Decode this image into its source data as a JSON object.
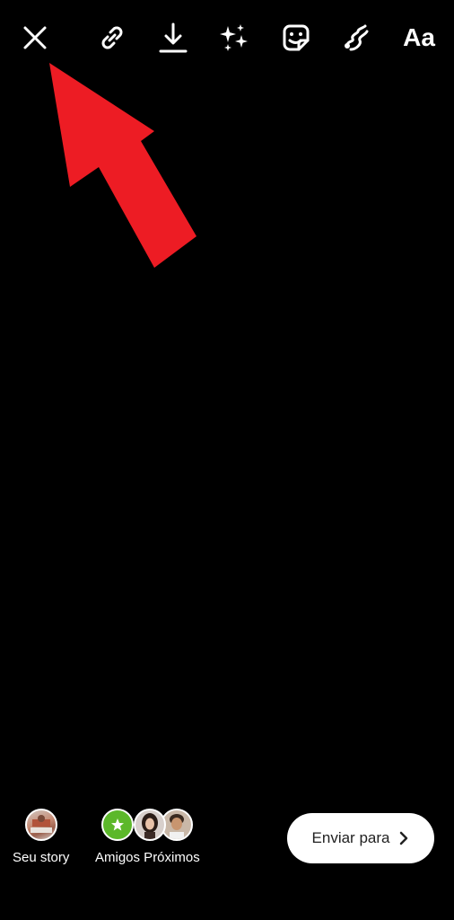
{
  "toolbar": {
    "close_icon": "close-icon",
    "link_icon": "link-icon",
    "download_icon": "download-icon",
    "effects_icon": "sparkles-icon",
    "sticker_icon": "sticker-icon",
    "draw_icon": "draw-icon",
    "text_tool_label": "Aa"
  },
  "annotation": {
    "arrow_color": "#ed1c24"
  },
  "share_bar": {
    "your_story_label": "Seu story",
    "close_friends_label": "Amigos Próximos",
    "close_friends_badge_color": "#5cb82a",
    "send_button_label": "Enviar para"
  },
  "colors": {
    "background": "#000000",
    "foreground": "#ffffff"
  }
}
